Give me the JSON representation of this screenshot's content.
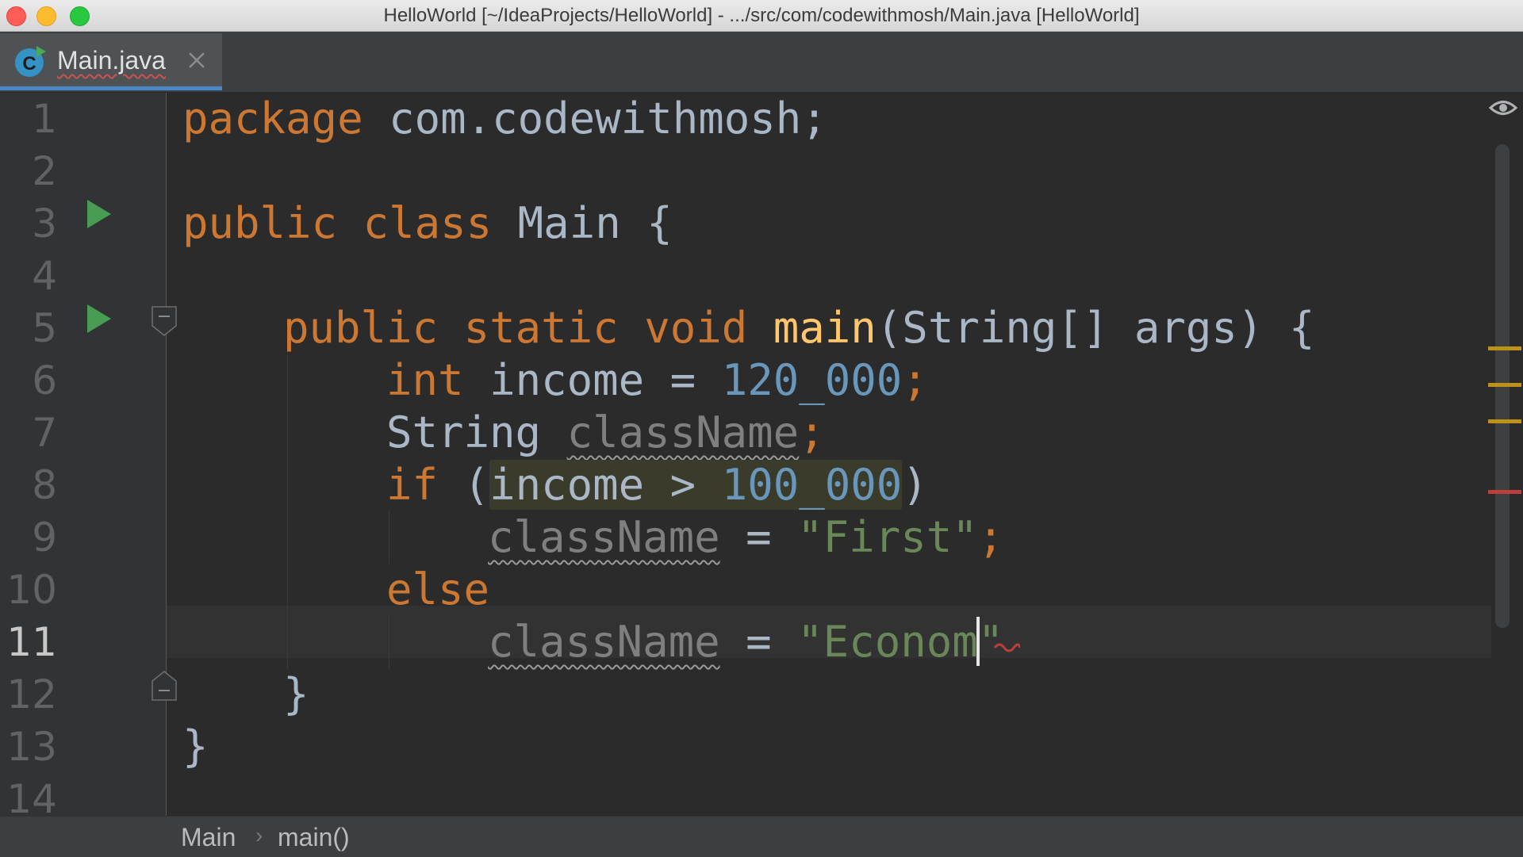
{
  "window": {
    "title": "HelloWorld [~/IdeaProjects/HelloWorld] - .../src/com/codewithmosh/Main.java [HelloWorld]"
  },
  "tabs": [
    {
      "label": "Main.java",
      "icon": "java-class-icon",
      "active": true
    }
  ],
  "gutter": {
    "line_numbers": [
      "1",
      "2",
      "3",
      "4",
      "5",
      "6",
      "7",
      "8",
      "9",
      "10",
      "11",
      "12",
      "13",
      "14"
    ],
    "current_line": "11"
  },
  "code": {
    "l1": {
      "kw": "package",
      "rest": " com.codewithmosh;"
    },
    "l3": {
      "kw1": "public",
      "kw2": "class",
      "name": "Main",
      "brace": "{"
    },
    "l5": {
      "kw1": "public",
      "kw2": "static",
      "kw3": "void",
      "fn": "main",
      "params": "(String[] args)",
      "brace": "{"
    },
    "l6": {
      "kw": "int",
      "var": "income",
      "op": "=",
      "num": "120_000",
      "semi": ";"
    },
    "l7": {
      "type": "String",
      "var": "className",
      "semi": ";"
    },
    "l8": {
      "kw": "if",
      "open": "(",
      "var": "income",
      "op": ">",
      "num": "100_000",
      "close": ")"
    },
    "l9": {
      "var": "className",
      "op": "=",
      "str": "\"First\"",
      "semi": ";"
    },
    "l10": {
      "kw": "else"
    },
    "l11": {
      "var": "className",
      "op": "=",
      "str_before_caret": "\"Econom",
      "str_after_caret": "\""
    },
    "l12": {
      "brace": "}"
    },
    "l13": {
      "brace": "}"
    }
  },
  "breadcrumb": {
    "items": [
      "Main",
      "main()"
    ],
    "separator": "›"
  },
  "colors": {
    "keyword": "#cc7832",
    "number": "#6897bb",
    "string": "#6a8759",
    "function": "#ffc66d",
    "text": "#a9b7c6",
    "warning_marker": "#be9117",
    "error_marker": "#bc3f3c"
  }
}
